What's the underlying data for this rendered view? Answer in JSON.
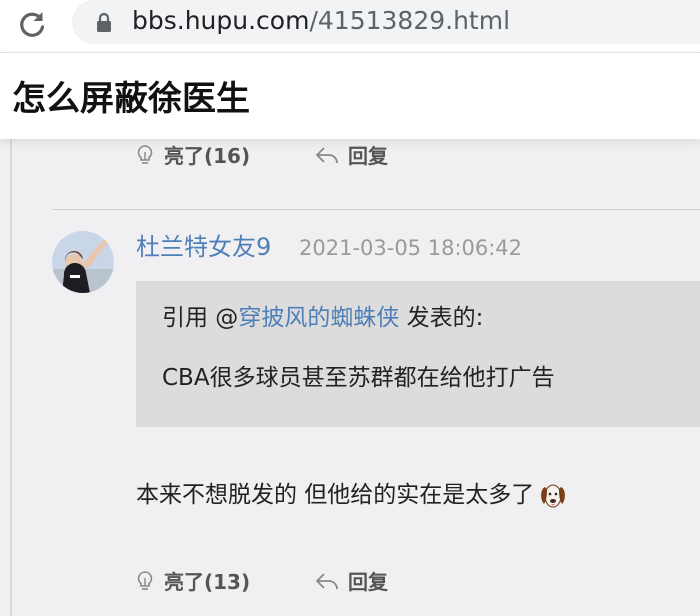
{
  "browser": {
    "url_host": "bbs.hupu.com",
    "url_path": "/41513829.html"
  },
  "page": {
    "title": "怎么屏蔽徐医生"
  },
  "previous_post_actions": {
    "like_label": "亮了(16)",
    "reply_label": "回复"
  },
  "post": {
    "username": "杜兰特女友9",
    "timestamp": "2021-03-05 18:06:42",
    "quote": {
      "prefix": "引用 @",
      "quoted_user": "穿披风的蜘蛛侠",
      "suffix": " 发表的:",
      "text": "CBA很多球员甚至苏群都在给他打广告"
    },
    "body": "本来不想脱发的 但他给的实在是太多了",
    "emoji_icon": "dog-face-icon",
    "actions": {
      "like_label": "亮了(13)",
      "reply_label": "回复"
    }
  },
  "colors": {
    "username": "#4f7fb7",
    "timestamp": "#9a9a9a",
    "quote_background": "#dcdcdc",
    "page_background": "#f0f0f2"
  }
}
